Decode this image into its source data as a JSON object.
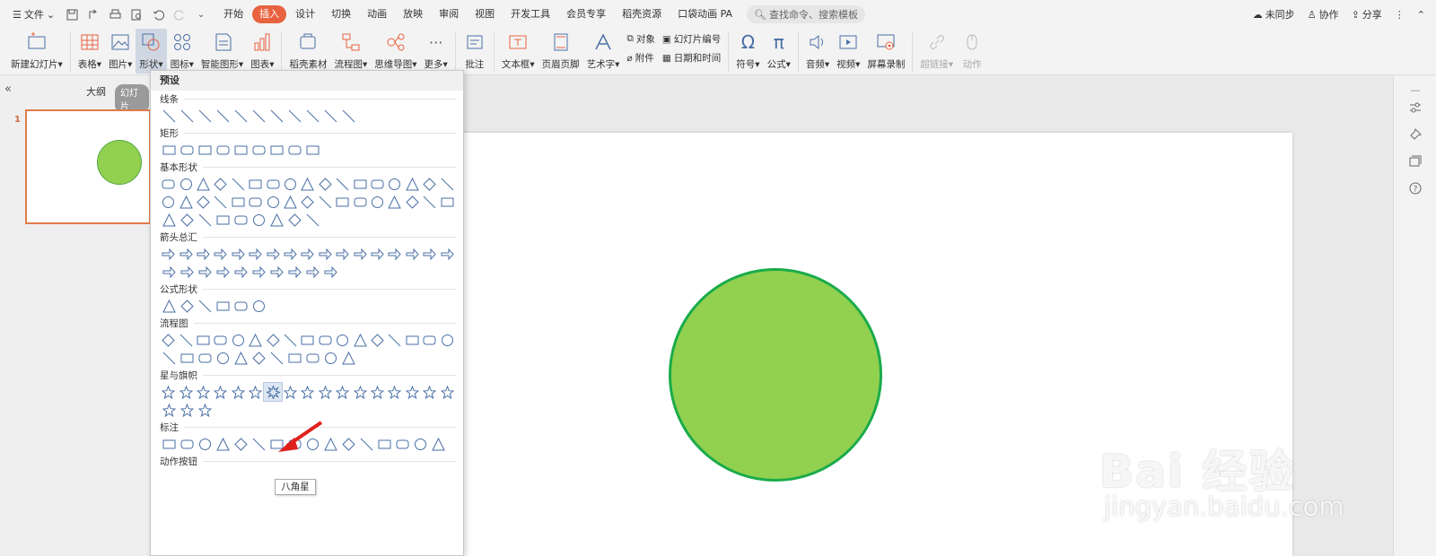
{
  "menubar": {
    "file_label": "文件",
    "tabs": [
      "开始",
      "插入",
      "设计",
      "切换",
      "动画",
      "放映",
      "审阅",
      "视图",
      "开发工具",
      "会员专享",
      "稻壳资源",
      "口袋动画 PA"
    ],
    "active_tab": "插入",
    "search_placeholder": "查找命令、搜索模板",
    "sync_label": "未同步",
    "collab_label": "协作",
    "share_label": "分享"
  },
  "ribbon": {
    "new_slide": "新建幻灯片",
    "table": "表格",
    "picture": "图片",
    "shape": "形状",
    "icon": "图标",
    "smartart": "智能图形",
    "chart": "图表",
    "daoke": "稻壳素材",
    "flowchart": "流程图",
    "mindmap": "思维导图",
    "more": "更多",
    "comment": "批注",
    "textbox": "文本框",
    "header_footer": "页眉页脚",
    "wordart": "艺术字",
    "object": "对象",
    "attachment": "附件",
    "slide_number": "幻灯片编号",
    "datetime": "日期和时间",
    "symbol": "符号",
    "formula": "公式",
    "audio": "音频",
    "video": "视频",
    "screen_record": "屏幕录制",
    "hyperlink": "超链接",
    "action": "动作"
  },
  "leftpanel": {
    "outline_tab": "大纲",
    "slides_tab": "幻灯片",
    "slide_number": "1"
  },
  "shape_panel": {
    "header": "预设",
    "categories": [
      {
        "title": "线条",
        "rows": [
          11
        ]
      },
      {
        "title": "矩形",
        "rows": [
          9
        ]
      },
      {
        "title": "基本形状",
        "rows": [
          17,
          17,
          9
        ]
      },
      {
        "title": "箭头总汇",
        "rows": [
          17,
          10
        ]
      },
      {
        "title": "公式形状",
        "rows": [
          6
        ]
      },
      {
        "title": "流程图",
        "rows": [
          17,
          11
        ]
      },
      {
        "title": "星与旗帜",
        "rows": [
          17,
          3
        ]
      },
      {
        "title": "标注",
        "rows": [
          16
        ]
      },
      {
        "title": "动作按钮",
        "rows": []
      }
    ],
    "tooltip": "八角星"
  },
  "colors": {
    "accent": "#e8623f",
    "circle_fill": "#92d050",
    "circle_stroke": "#1aab4a",
    "shape_stroke": "#4a6fa5",
    "arrow": "#e0201b"
  },
  "watermark": {
    "line1": "Bai 经验",
    "line2": "jingyan.baidu.com"
  }
}
